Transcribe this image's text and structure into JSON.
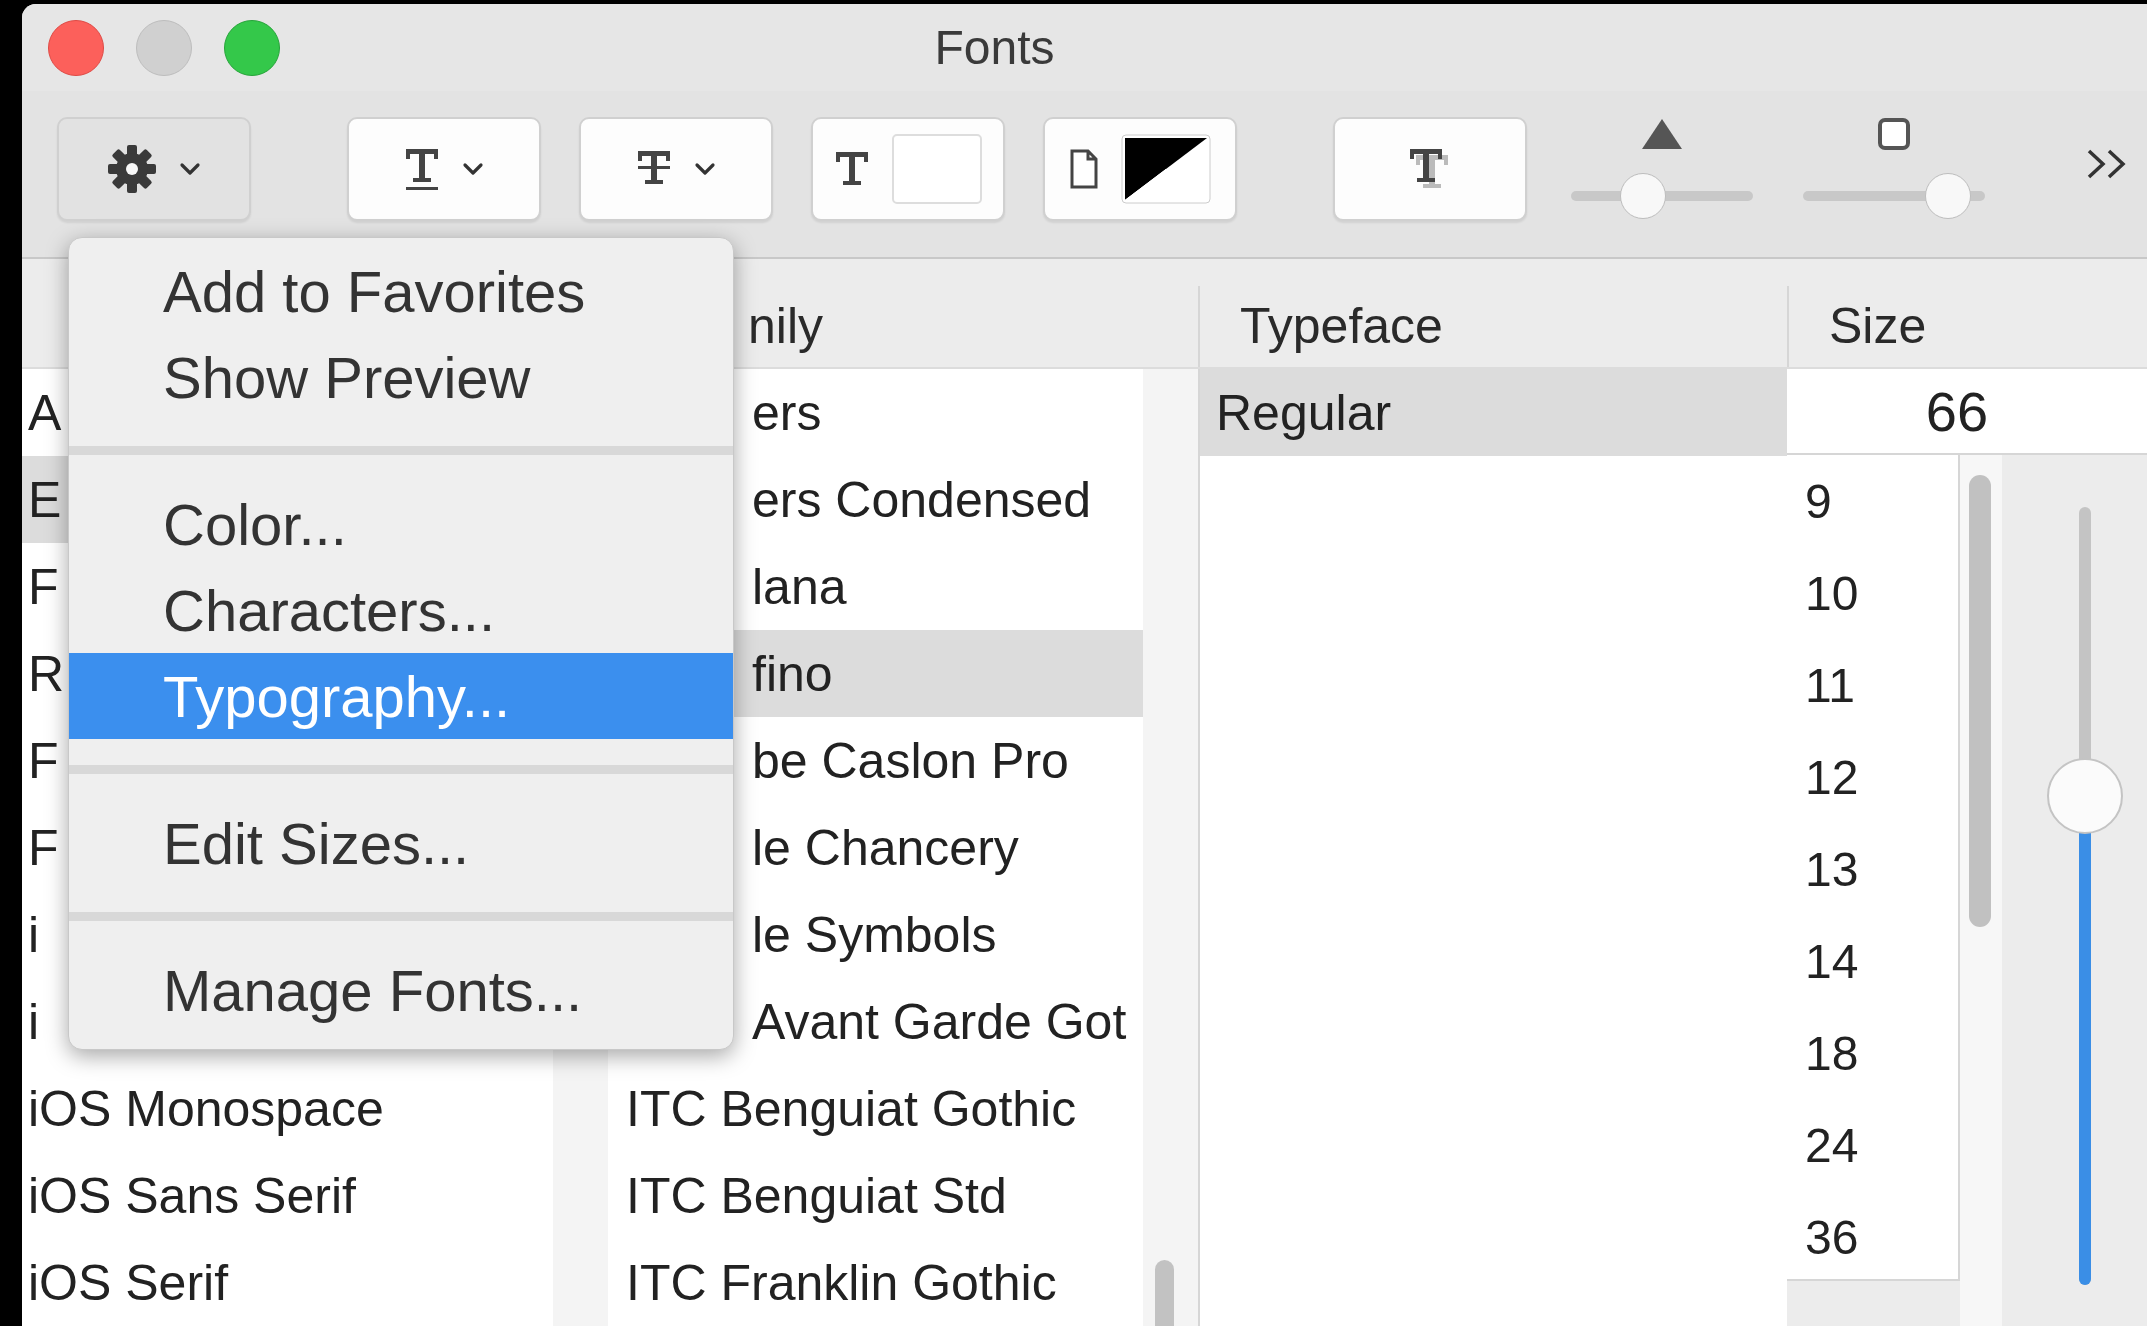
{
  "window": {
    "title": "Fonts"
  },
  "toolbar": {
    "sliders": [
      {
        "level": 0.36
      },
      {
        "level": 0.9
      }
    ]
  },
  "collections": {
    "rows": [
      {
        "label": "A",
        "selected": false
      },
      {
        "label": "E",
        "selected": true
      },
      {
        "label": "F",
        "selected": false
      },
      {
        "label": "R",
        "selected": false
      },
      {
        "label": "F",
        "selected": false
      },
      {
        "label": "F",
        "selected": false
      },
      {
        "label": "i",
        "selected": false
      },
      {
        "label": "i",
        "selected": false
      },
      {
        "label": "iOS Monospace",
        "selected": false
      },
      {
        "label": "iOS Sans Serif",
        "selected": false
      },
      {
        "label": "iOS Serif",
        "selected": false
      }
    ]
  },
  "family": {
    "header": "nily",
    "rows": [
      {
        "label": "ers",
        "selected": false
      },
      {
        "label": "ers Condensed",
        "selected": false
      },
      {
        "label": "lana",
        "selected": false
      },
      {
        "label": "fino",
        "selected": true
      },
      {
        "label": "be Caslon Pro",
        "selected": false
      },
      {
        "label": "le Chancery",
        "selected": false
      },
      {
        "label": "le Symbols",
        "selected": false
      },
      {
        "label": "Avant Garde Got",
        "selected": false
      },
      {
        "label": "ITC Benguiat Gothic",
        "selected": false
      },
      {
        "label": "ITC Benguiat Std",
        "selected": false
      },
      {
        "label": "ITC Franklin Gothic",
        "selected": false
      }
    ]
  },
  "typeface": {
    "header": "Typeface",
    "rows": [
      {
        "label": "Regular",
        "selected": true
      }
    ]
  },
  "size": {
    "header": "Size",
    "value": "66",
    "rows": [
      "9",
      "10",
      "11",
      "12",
      "13",
      "14",
      "18",
      "24",
      "36"
    ],
    "slider": {
      "level": 0.64
    }
  },
  "menu": {
    "groups": [
      [
        {
          "label": "Add to Favorites",
          "selected": false
        },
        {
          "label": "Show Preview",
          "selected": false
        }
      ],
      [
        {
          "label": "Color...",
          "selected": false
        },
        {
          "label": "Characters...",
          "selected": false
        },
        {
          "label": "Typography...",
          "selected": true
        }
      ],
      [
        {
          "label": "Edit Sizes...",
          "selected": false
        }
      ],
      [
        {
          "label": "Manage Fonts...",
          "selected": false
        }
      ]
    ]
  }
}
